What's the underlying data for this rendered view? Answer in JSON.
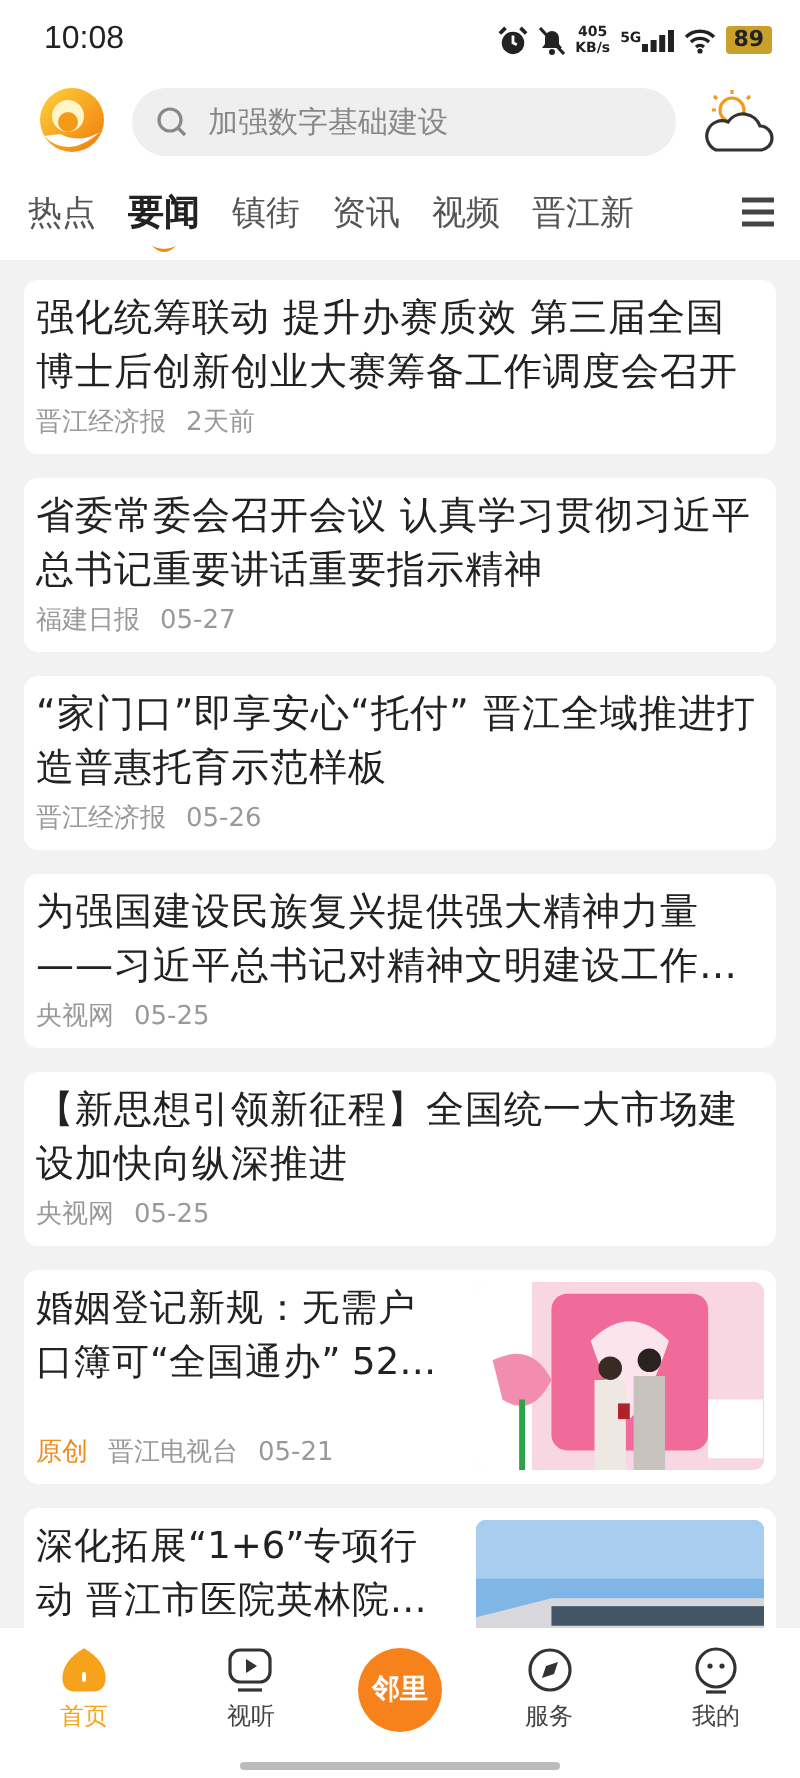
{
  "status_bar": {
    "time": "10:08",
    "speed_value": "405",
    "speed_unit": "KB/s",
    "network": "5G",
    "battery": "89"
  },
  "header": {
    "search": {
      "placeholder": "加强数字基础建设"
    }
  },
  "tabs": [
    {
      "label": "热点",
      "selected": false
    },
    {
      "label": "要闻",
      "selected": true
    },
    {
      "label": "镇街",
      "selected": false
    },
    {
      "label": "资讯",
      "selected": false
    },
    {
      "label": "视频",
      "selected": false
    },
    {
      "label": "晋江新",
      "selected": false
    }
  ],
  "articles": [
    {
      "kind": "text",
      "title": "强化统筹联动 提升办赛质效 第三届全国博士后创新创业大赛筹备工作调度会召开",
      "source": "晋江经济报",
      "date": "2天前"
    },
    {
      "kind": "text",
      "title": "省委常委会召开会议 认真学习贯彻习近平总书记重要讲话重要指示精神",
      "source": "福建日报",
      "date": "05-27"
    },
    {
      "kind": "text",
      "title": "“家门口”即享安心“托付” 晋江全域推进打造普惠托育示范样板",
      "source": "晋江经济报",
      "date": "05-26"
    },
    {
      "kind": "text",
      "title": "为强国建设民族复兴提供强大精神力量——习近平总书记对精神文明建设工作…",
      "source": "央视网",
      "date": "05-25"
    },
    {
      "kind": "text",
      "title": "【新思想引领新征程】全国统一大市场建设加快向纵深推进",
      "source": "央视网",
      "date": "05-25"
    },
    {
      "title": "婚姻登记新规：无需户口簿可“全国通办” 52…",
      "tag": "原创",
      "source": "晋江电视台",
      "date": "05-21"
    },
    {
      "title": "深化拓展“1+6”专项行动 晋江市医院英林院…"
    }
  ],
  "bottom_nav": [
    {
      "label": "首页",
      "selected": true,
      "kind": "tab"
    },
    {
      "label": "视听",
      "selected": false,
      "kind": "tab"
    },
    {
      "label": "邻里",
      "kind": "center"
    },
    {
      "label": "服务",
      "selected": false,
      "kind": "tab"
    },
    {
      "label": "我的",
      "selected": false,
      "kind": "tab"
    }
  ]
}
